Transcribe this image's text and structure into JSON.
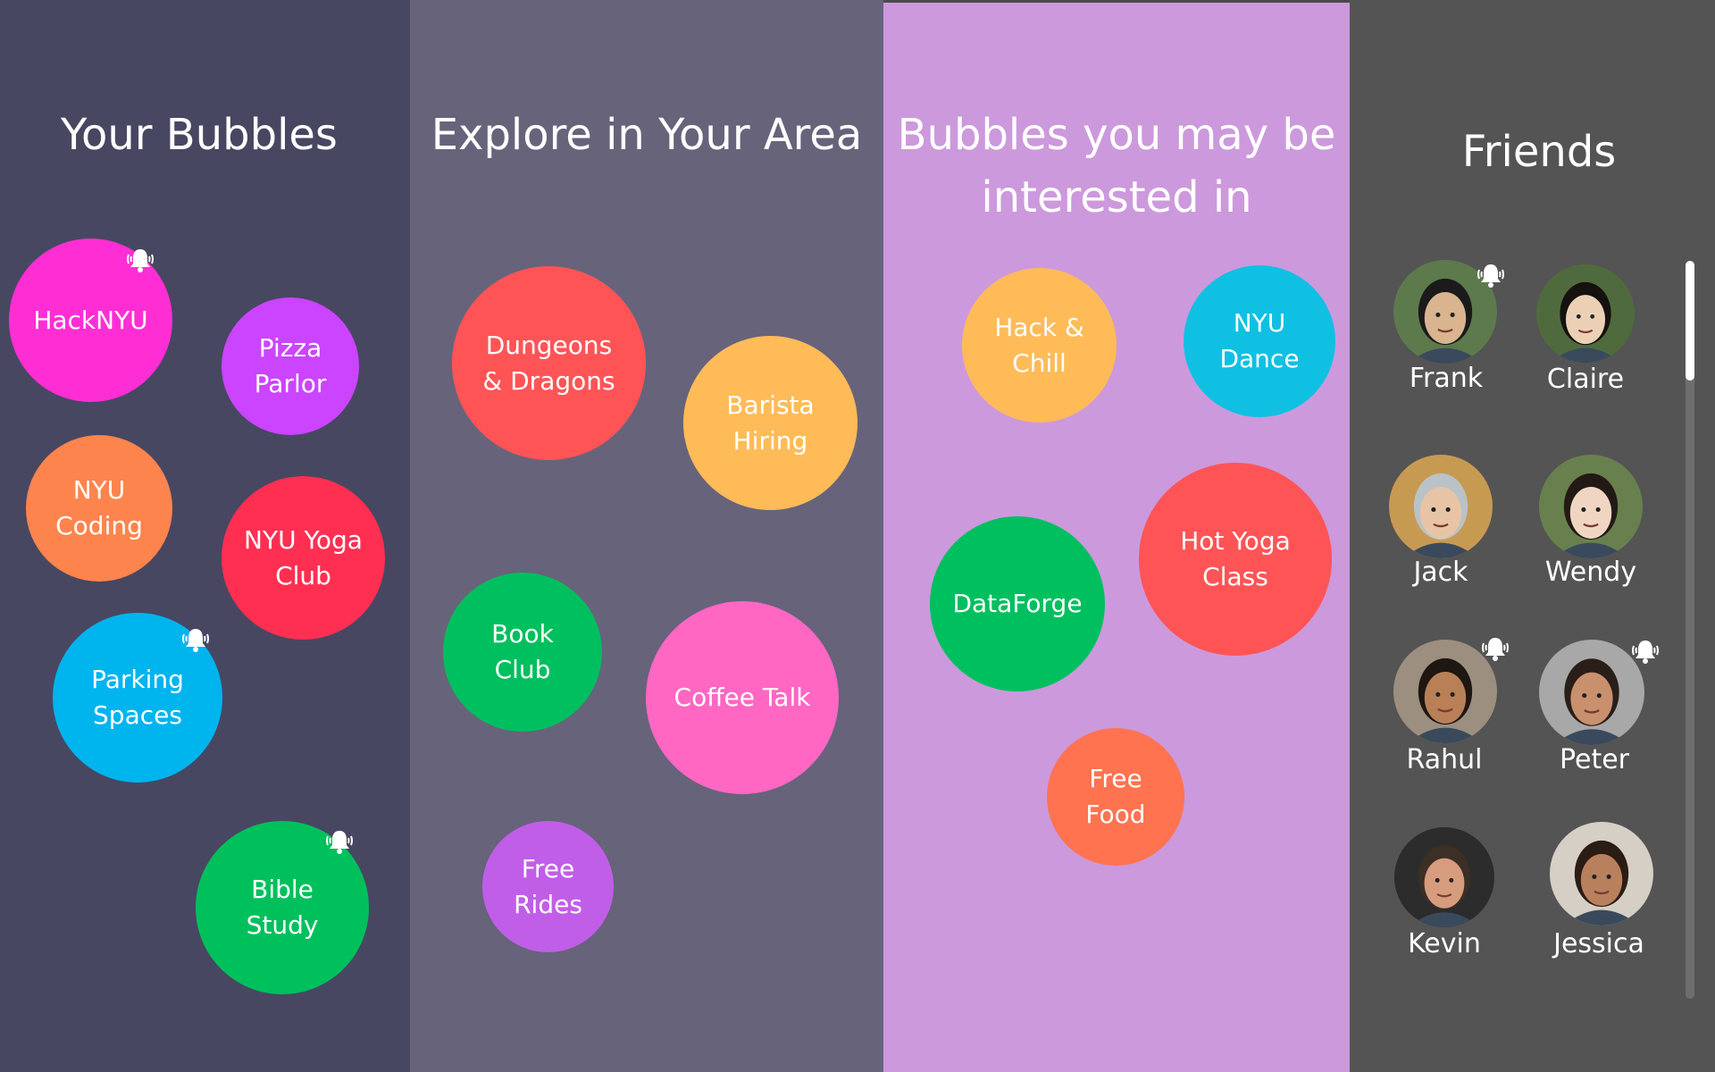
{
  "colors": {
    "col_your_bubbles": "#474762",
    "col_explore": "#67637b",
    "col_interested": "#cc99dc",
    "col_friends": "#545454",
    "top_border": "#4a4a4a"
  },
  "your_bubbles": {
    "title": "Your Bubbles",
    "bubbles": [
      {
        "label": "HackNYU",
        "color": "#ff2ed4",
        "bell": true
      },
      {
        "label": "Pizza\nParlor",
        "color": "#cb44ff",
        "bell": false
      },
      {
        "label": "NYU\nCoding",
        "color": "#fe844d",
        "bell": false
      },
      {
        "label": "NYU Yoga\nClub",
        "color": "#ff2f52",
        "bell": false
      },
      {
        "label": "Parking\nSpaces",
        "color": "#00b4ee",
        "bell": true
      },
      {
        "label": "Bible\nStudy",
        "color": "#00c05c",
        "bell": true
      }
    ]
  },
  "explore": {
    "title": "Explore in Your Area",
    "bubbles": [
      {
        "label": "Dungeons\n& Dragons",
        "color": "#ff5456"
      },
      {
        "label": "Barista\nHiring",
        "color": "#ffbb58"
      },
      {
        "label": "Book\nClub",
        "color": "#00bf5f"
      },
      {
        "label": "Coffee Talk",
        "color": "#ff67c3"
      },
      {
        "label": "Free\nRides",
        "color": "#c15ee8"
      }
    ]
  },
  "interested": {
    "title": "Bubbles you may be\ninterested in",
    "bubbles": [
      {
        "label": "Hack &\nChill",
        "color": "#ffbb58"
      },
      {
        "label": "NYU\nDance",
        "color": "#0fc0e3"
      },
      {
        "label": "DataForge",
        "color": "#00bf5f"
      },
      {
        "label": "Hot Yoga\nClass",
        "color": "#ff5456"
      },
      {
        "label": "Free\nFood",
        "color": "#ff7350"
      }
    ]
  },
  "friends": {
    "title": "Friends",
    "list": [
      {
        "name": "Frank",
        "bell": true,
        "skin": "#d9b48f",
        "hair": "#1b1b1b",
        "bg": "#5d7a4c"
      },
      {
        "name": "Claire",
        "bell": false,
        "skin": "#ecd0b6",
        "hair": "#15120f",
        "bg": "#4f6b3d"
      },
      {
        "name": "Jack",
        "bell": false,
        "skin": "#e7c4a6",
        "hair": "#b9c2c7",
        "bg": "#c79a52"
      },
      {
        "name": "Wendy",
        "bell": false,
        "skin": "#f0d6c2",
        "hair": "#231a16",
        "bg": "#68804e"
      },
      {
        "name": "Rahul",
        "bell": true,
        "skin": "#b98058",
        "hair": "#1e1712",
        "bg": "#9c8f7f"
      },
      {
        "name": "Peter",
        "bell": true,
        "skin": "#c9906e",
        "hair": "#2a1e18",
        "bg": "#a8a8a8"
      },
      {
        "name": "Kevin",
        "bell": false,
        "skin": "#d69c7d",
        "hair": "#3b2f26",
        "bg": "#2c2c2c"
      },
      {
        "name": "Jessica",
        "bell": false,
        "skin": "#b9805e",
        "hair": "#2b1c14",
        "bg": "#d6cfc6"
      }
    ]
  }
}
